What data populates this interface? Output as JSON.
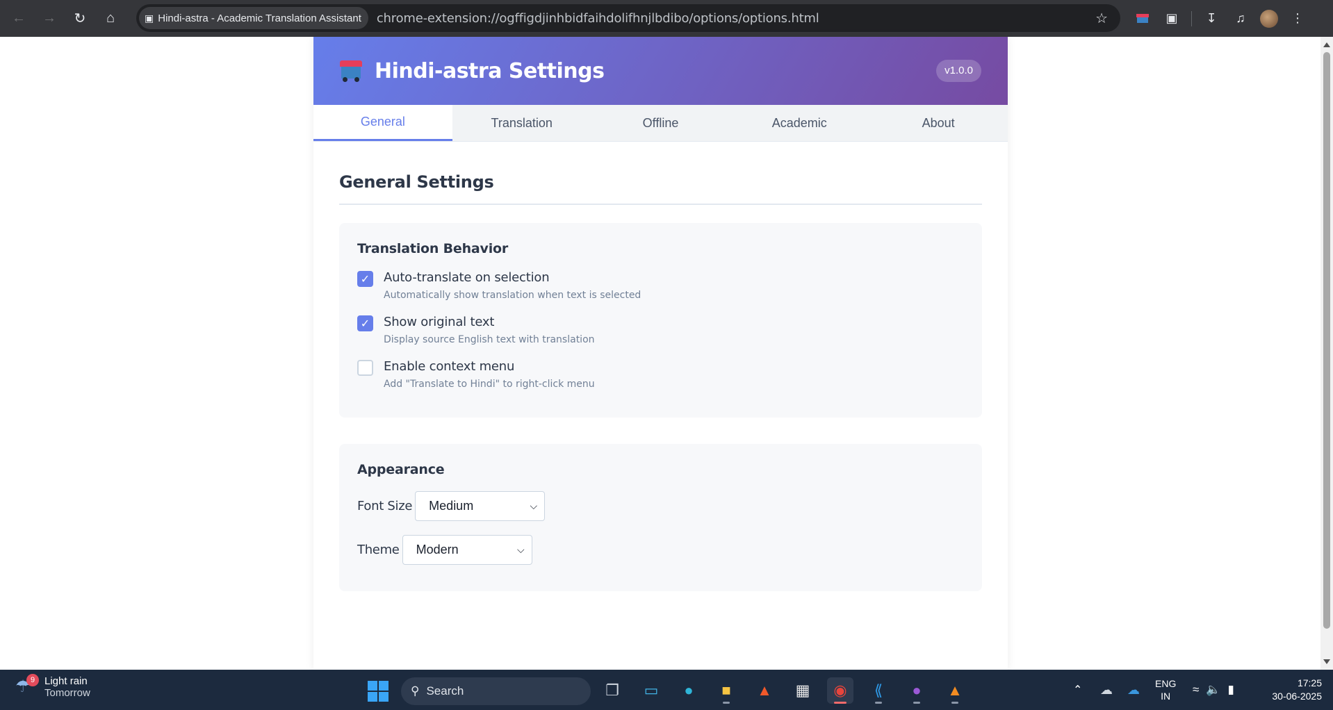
{
  "browser": {
    "tab_title": "Hindi-astra - Academic Translation Assistant",
    "url": "chrome-extension://ogffigdjinhbidfaihdolifhnjlbdibo/options/options.html"
  },
  "header": {
    "title": "Hindi-astra Settings",
    "version": "v1.0.0"
  },
  "tabs": [
    {
      "label": "General",
      "active": true
    },
    {
      "label": "Translation",
      "active": false
    },
    {
      "label": "Offline",
      "active": false
    },
    {
      "label": "Academic",
      "active": false
    },
    {
      "label": "About",
      "active": false
    }
  ],
  "general": {
    "title": "General Settings",
    "behavior": {
      "title": "Translation Behavior",
      "options": [
        {
          "label": "Auto-translate on selection",
          "description": "Automatically show translation when text is selected",
          "checked": true
        },
        {
          "label": "Show original text",
          "description": "Display source English text with translation",
          "checked": true
        },
        {
          "label": "Enable context menu",
          "description": "Add \"Translate to Hindi\" to right-click menu",
          "checked": false
        }
      ]
    },
    "appearance": {
      "title": "Appearance",
      "font_size_label": "Font Size",
      "font_size_value": "Medium",
      "theme_label": "Theme",
      "theme_value": "Modern"
    }
  },
  "taskbar": {
    "weather_badge": "9",
    "weather_line1": "Light rain",
    "weather_line2": "Tomorrow",
    "search_placeholder": "Search",
    "lang_line1": "ENG",
    "lang_line2": "IN",
    "time": "17:25",
    "date": "30-06-2025"
  },
  "colors": {
    "accent": "#667eea",
    "header_gradient_end": "#764ba2"
  }
}
